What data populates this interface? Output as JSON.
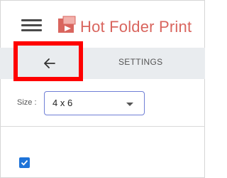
{
  "header": {
    "title": "Hot Folder Print",
    "title_color": "#d9655e",
    "menu_icon": "hamburger-menu-icon",
    "logo_icon": "folder-printer-logo-icon"
  },
  "toolbar": {
    "back_icon": "arrow-left-icon",
    "settings_label": "SETTINGS",
    "highlight_color": "#ff0000"
  },
  "size": {
    "label": "Size :",
    "value": "4 x 6",
    "dropdown_icon": "caret-down-icon"
  },
  "checkbox": {
    "checked": true,
    "color": "#1e73d8"
  }
}
